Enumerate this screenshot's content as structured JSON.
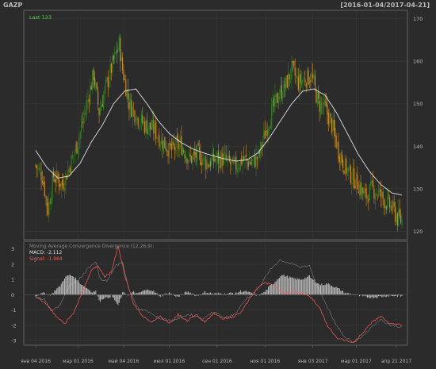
{
  "header": {
    "ticker": "GAZP",
    "date_range": "[2016-01-04/2017-04-21]"
  },
  "colors": {
    "background": "#2b2b2b",
    "panel_border": "#6f6f6f",
    "grid": "#3a3a3a",
    "text": "#b9b9b9",
    "candle_up": "#2f7d1e",
    "candle_down": "#c98a28",
    "sma": "#e0e0e0",
    "last_label": "#4be04b",
    "macd_histogram": "#bdbdbd",
    "signal_line": "#ff5a5a",
    "macd_line": "#e0e0e0"
  },
  "chart_data": [
    {
      "type": "candlestick",
      "title": "GAZP",
      "date_range": "[2016-01-04/2017-04-21]",
      "last_label": "Last 123",
      "y_ticks": [
        120,
        130,
        140,
        150,
        160,
        170
      ],
      "ylim": [
        118,
        172
      ],
      "grid": true,
      "overlay": "moving average (white line)",
      "n_bars": 330,
      "close_anchors": [
        [
          0,
          135.5
        ],
        [
          6,
          133
        ],
        [
          11,
          125
        ],
        [
          16,
          133
        ],
        [
          24,
          131
        ],
        [
          30,
          135
        ],
        [
          38,
          141
        ],
        [
          46,
          150
        ],
        [
          52,
          157
        ],
        [
          57,
          148
        ],
        [
          62,
          153
        ],
        [
          70,
          160
        ],
        [
          75,
          164
        ],
        [
          78,
          158
        ],
        [
          84,
          150
        ],
        [
          91,
          147
        ],
        [
          98,
          145
        ],
        [
          106,
          144
        ],
        [
          114,
          141
        ],
        [
          122,
          139
        ],
        [
          130,
          140.5
        ],
        [
          138,
          137
        ],
        [
          146,
          138
        ],
        [
          154,
          136
        ],
        [
          162,
          137
        ],
        [
          170,
          137
        ],
        [
          178,
          135
        ],
        [
          186,
          137
        ],
        [
          194,
          136
        ],
        [
          200,
          137.5
        ],
        [
          206,
          143
        ],
        [
          212,
          148
        ],
        [
          218,
          152
        ],
        [
          224,
          154
        ],
        [
          230,
          158
        ],
        [
          236,
          155
        ],
        [
          242,
          156
        ],
        [
          248,
          156.5
        ],
        [
          254,
          150
        ],
        [
          260,
          149
        ],
        [
          266,
          145
        ],
        [
          272,
          139
        ],
        [
          278,
          135
        ],
        [
          284,
          133
        ],
        [
          290,
          131
        ],
        [
          296,
          128
        ],
        [
          302,
          130
        ],
        [
          308,
          129
        ],
        [
          314,
          127
        ],
        [
          320,
          125.5
        ],
        [
          325,
          123
        ],
        [
          329,
          122.5
        ]
      ],
      "sma_anchors": [
        [
          0,
          139
        ],
        [
          10,
          135
        ],
        [
          20,
          132.5
        ],
        [
          30,
          133
        ],
        [
          40,
          136
        ],
        [
          50,
          141
        ],
        [
          60,
          145
        ],
        [
          70,
          150
        ],
        [
          80,
          153
        ],
        [
          90,
          153.5
        ],
        [
          100,
          150
        ],
        [
          110,
          146
        ],
        [
          120,
          143
        ],
        [
          130,
          141
        ],
        [
          140,
          139.5
        ],
        [
          150,
          138.5
        ],
        [
          160,
          137.7
        ],
        [
          170,
          137
        ],
        [
          180,
          136.5
        ],
        [
          190,
          136.8
        ],
        [
          200,
          138.5
        ],
        [
          210,
          142
        ],
        [
          220,
          146
        ],
        [
          230,
          150
        ],
        [
          240,
          153
        ],
        [
          250,
          153.5
        ],
        [
          260,
          152
        ],
        [
          270,
          148
        ],
        [
          280,
          143
        ],
        [
          290,
          138
        ],
        [
          300,
          134
        ],
        [
          310,
          131
        ],
        [
          320,
          129
        ],
        [
          329,
          128.5
        ]
      ]
    },
    {
      "type": "line",
      "title": "Moving Average Convergence Divergence (12,26,9):",
      "series": [
        {
          "name": "MACD",
          "last_value_label": "MACD: -2.112"
        },
        {
          "name": "Signal",
          "last_value_label": "Signal: -1.964"
        }
      ],
      "y_ticks": [
        -3,
        -2,
        -1,
        0,
        1,
        2,
        3
      ],
      "ylim": [
        -3.3,
        3.5
      ],
      "grid": true,
      "macd_anchors": [
        [
          0,
          -0.2
        ],
        [
          8,
          -0.3
        ],
        [
          14,
          -1.0
        ],
        [
          22,
          -0.7
        ],
        [
          30,
          0.6
        ],
        [
          40,
          1.1
        ],
        [
          48,
          1.8
        ],
        [
          54,
          2.2
        ],
        [
          58,
          1.0
        ],
        [
          64,
          0.9
        ],
        [
          72,
          1.9
        ],
        [
          78,
          2.1
        ],
        [
          84,
          0.3
        ],
        [
          92,
          -0.9
        ],
        [
          100,
          -1.1
        ],
        [
          110,
          -1.5
        ],
        [
          120,
          -1.7
        ],
        [
          130,
          -1.5
        ],
        [
          140,
          -1.3
        ],
        [
          150,
          -1.6
        ],
        [
          160,
          -1.1
        ],
        [
          170,
          -1.5
        ],
        [
          180,
          -1.2
        ],
        [
          190,
          -0.2
        ],
        [
          200,
          0.4
        ],
        [
          210,
          1.6
        ],
        [
          220,
          2.3
        ],
        [
          230,
          2.0
        ],
        [
          238,
          1.8
        ],
        [
          246,
          1.9
        ],
        [
          254,
          0.4
        ],
        [
          262,
          -0.8
        ],
        [
          270,
          -2.0
        ],
        [
          278,
          -2.8
        ],
        [
          286,
          -3.1
        ],
        [
          294,
          -2.7
        ],
        [
          302,
          -2.1
        ],
        [
          310,
          -1.6
        ],
        [
          318,
          -2.0
        ],
        [
          329,
          -2.112
        ]
      ],
      "signal_anchors": [
        [
          0,
          -0.1
        ],
        [
          10,
          -0.6
        ],
        [
          18,
          -1.4
        ],
        [
          26,
          -1.9
        ],
        [
          34,
          -1.2
        ],
        [
          42,
          0.2
        ],
        [
          50,
          1.6
        ],
        [
          56,
          1.9
        ],
        [
          62,
          1.2
        ],
        [
          68,
          1.5
        ],
        [
          74,
          3.2
        ],
        [
          80,
          1.3
        ],
        [
          88,
          -0.6
        ],
        [
          96,
          -1.4
        ],
        [
          104,
          -1.8
        ],
        [
          112,
          -1.4
        ],
        [
          120,
          -1.9
        ],
        [
          128,
          -1.3
        ],
        [
          136,
          -1.7
        ],
        [
          144,
          -1.3
        ],
        [
          152,
          -1.8
        ],
        [
          160,
          -1.2
        ],
        [
          168,
          -1.6
        ],
        [
          176,
          -1.5
        ],
        [
          184,
          -1.2
        ],
        [
          192,
          -0.3
        ],
        [
          200,
          0.5
        ],
        [
          206,
          0.8
        ],
        [
          214,
          0.6
        ],
        [
          222,
          0.1
        ],
        [
          232,
          0.2
        ],
        [
          240,
          0.1
        ],
        [
          248,
          -0.2
        ],
        [
          256,
          -1.0
        ],
        [
          262,
          -2.0
        ],
        [
          270,
          -2.8
        ],
        [
          278,
          -3.0
        ],
        [
          286,
          -3.1
        ],
        [
          294,
          -2.5
        ],
        [
          302,
          -1.8
        ],
        [
          310,
          -1.4
        ],
        [
          318,
          -1.9
        ],
        [
          329,
          -1.964
        ]
      ],
      "histogram_note": "MACD minus Signal (light bars)"
    }
  ],
  "x_axis": {
    "bar_count": 330,
    "ticks": [
      {
        "label": "янв 04 2016",
        "bar": 0
      },
      {
        "label": "мар 01 2016",
        "bar": 38
      },
      {
        "label": "май 04 2016",
        "bar": 79
      },
      {
        "label": "июл 01 2016",
        "bar": 120
      },
      {
        "label": "сен 01 2016",
        "bar": 163
      },
      {
        "label": "ноя 01 2016",
        "bar": 206
      },
      {
        "label": "янв 03 2017",
        "bar": 249
      },
      {
        "label": "мар 01 2017",
        "bar": 288
      },
      {
        "label": "апр 21 2017",
        "bar": 324
      }
    ]
  }
}
